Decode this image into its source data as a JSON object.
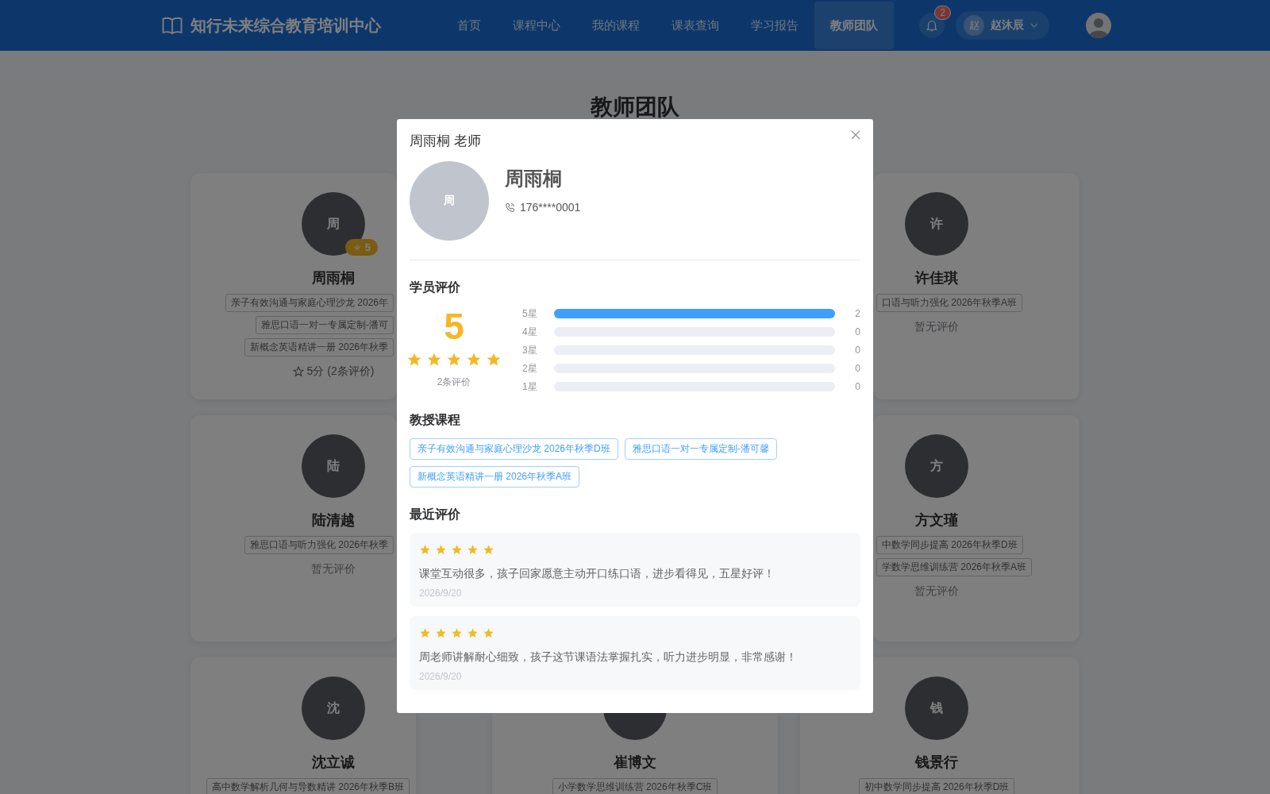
{
  "header": {
    "logo": "知行未来综合教育培训中心",
    "nav": [
      {
        "label": "首页",
        "selected": false
      },
      {
        "label": "课程中心",
        "selected": false
      },
      {
        "label": "我的课程",
        "selected": false
      },
      {
        "label": "课表查询",
        "selected": false
      },
      {
        "label": "学习报告",
        "selected": false
      },
      {
        "label": "教师团队",
        "selected": true
      }
    ],
    "notification_count": "2",
    "user": {
      "avatar_text": "赵",
      "name": "赵沐辰"
    }
  },
  "page_title": "教师团队",
  "card_rows": [
    {
      "cells": [
        {
          "avatar_text": "周",
          "rating_badge": "5",
          "name": "周雨桐",
          "courses": [
            "亲子有效沟通与家庭心理沙龙 2026年",
            "雅思口语一对一专属定制-潘可",
            "新概念英语精讲一册 2026年秋季"
          ],
          "rating": {
            "kind": "score",
            "text": "5分 (2条评价)"
          }
        },
        null,
        {
          "avatar_text": "许",
          "name": "许佳琪",
          "courses": [
            "口语与听力强化 2026年秋季A班"
          ],
          "rating": {
            "kind": "empty",
            "text": "暂无评价"
          }
        }
      ]
    },
    {
      "cells": [
        {
          "avatar_text": "陆",
          "name": "陆清越",
          "courses": [
            "雅思口语与听力强化 2026年秋季"
          ],
          "rating": {
            "kind": "empty",
            "text": "暂无评价"
          }
        },
        null,
        {
          "avatar_text": "方",
          "name": "方文瑾",
          "courses": [
            "中数学同步提高 2026年秋季D班",
            "学数学思维训练营 2026年秋季A班"
          ],
          "rating": {
            "kind": "empty",
            "text": "暂无评价"
          }
        }
      ]
    },
    {
      "cells": [
        {
          "avatar_text": "沈",
          "name": "沈立诚",
          "courses": [
            "高中数学解析几何与导数精讲 2026年秋季B班"
          ]
        },
        {
          "name": "崔博文",
          "courses": [
            "小学数学思维训练营 2026年秋季C班"
          ]
        },
        {
          "avatar_text": "钱",
          "name": "钱景行",
          "courses": [
            "初中数学同步提高 2026年秋季D班"
          ]
        }
      ]
    }
  ],
  "modal": {
    "title": "周雨桐 老师",
    "avatar_text": "周",
    "name": "周雨桐",
    "phone": "176****0001",
    "ratings_heading": "学员评价",
    "score": "5",
    "stars": 5,
    "review_count": "2条评价",
    "distribution": [
      {
        "label": "5星",
        "level": 1,
        "count": "2"
      },
      {
        "label": "4星",
        "level": 0,
        "count": "0"
      },
      {
        "label": "3星",
        "level": 0,
        "count": "0"
      },
      {
        "label": "2星",
        "level": 0,
        "count": "0"
      },
      {
        "label": "1星",
        "level": 0,
        "count": "0"
      }
    ],
    "courses_heading": "教授课程",
    "courses": [
      "亲子有效沟通与家庭心理沙龙 2026年秋季D班",
      "雅思口语一对一专属定制-潘可馨",
      "新概念英语精讲一册 2026年秋季A班"
    ],
    "reviews_heading": "最近评价",
    "reviews": [
      {
        "stars": 5,
        "text": "课堂互动很多，孩子回家愿意主动开口练口语，进步看得见，五星好评！",
        "date": "2026/9/20"
      },
      {
        "stars": 5,
        "text": "周老师讲解耐心细致，孩子这节课语法掌握扎实，听力进步明显，非常感谢！",
        "date": "2026/9/20"
      }
    ]
  }
}
